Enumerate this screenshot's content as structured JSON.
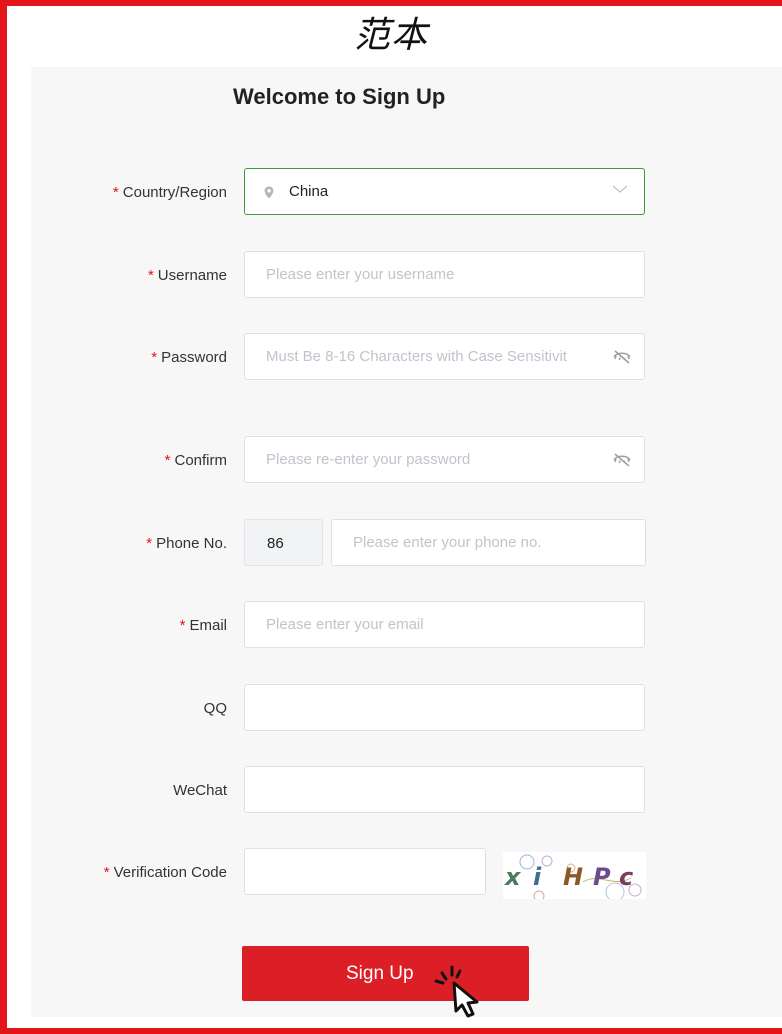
{
  "corner_title": "范本",
  "heading": "Welcome to Sign Up",
  "required_mark": "*",
  "fields": {
    "country": {
      "label": "Country/Region",
      "value": "China",
      "icon": "location-pin-icon"
    },
    "username": {
      "label": "Username",
      "placeholder": "Please enter your username"
    },
    "password": {
      "label": "Password",
      "placeholder": "Must Be 8-16 Characters with Case Sensitivit",
      "icon": "eye-hidden-icon"
    },
    "confirm": {
      "label": "Confirm",
      "placeholder": "Please re-enter your password",
      "icon": "eye-hidden-icon"
    },
    "phone": {
      "label": "Phone No.",
      "prefix": "86",
      "placeholder": "Please enter your phone no."
    },
    "email": {
      "label": "Email",
      "placeholder": "Please enter your email"
    },
    "qq": {
      "label": "QQ"
    },
    "wechat": {
      "label": "WeChat"
    },
    "verification": {
      "label": "Verification Code",
      "captcha_text": "xiHPc"
    }
  },
  "submit_label": "Sign Up",
  "colors": {
    "frame": "#e3151b",
    "button": "#dc1f26",
    "focus": "#3c9b3c"
  }
}
